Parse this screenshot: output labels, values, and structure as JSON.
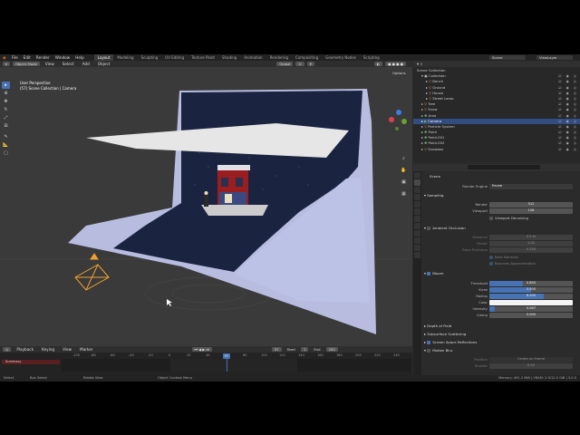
{
  "menu": {
    "items": [
      "File",
      "Edit",
      "Render",
      "Window",
      "Help"
    ],
    "workspaces": [
      "Layout",
      "Modeling",
      "Sculpting",
      "UV Editing",
      "Texture Paint",
      "Shading",
      "Animation",
      "Rendering",
      "Compositing",
      "Geometry Nodes",
      "Scripting"
    ],
    "active_workspace": "Layout",
    "scene": "Scene",
    "view_layer": "ViewLayer"
  },
  "viewport_header": {
    "mode": "Object Mode",
    "menus": [
      "View",
      "Select",
      "Add",
      "Object"
    ],
    "transform_orientation": "Global",
    "options": "Options"
  },
  "viewport": {
    "perspective_label": "User Perspective",
    "collection_label": "(57) Scene Collection | Camera"
  },
  "outliner": {
    "rows": [
      {
        "label": "Scene Collection",
        "indent": 0,
        "selected": false
      },
      {
        "label": "Collection",
        "indent": 1,
        "selected": false
      },
      {
        "label": "Bench",
        "indent": 2,
        "selected": false
      },
      {
        "label": "Ground",
        "indent": 2,
        "selected": false
      },
      {
        "label": "House",
        "indent": 2,
        "selected": false
      },
      {
        "label": "Street Lamp",
        "indent": 2,
        "selected": false
      },
      {
        "label": "Tree",
        "indent": 1,
        "selected": false
      },
      {
        "label": "Snow",
        "indent": 1,
        "selected": false
      },
      {
        "label": "Area",
        "indent": 1,
        "selected": false
      },
      {
        "label": "Camera",
        "indent": 1,
        "selected": true
      },
      {
        "label": "Particle System",
        "indent": 1,
        "selected": false
      },
      {
        "label": "Point",
        "indent": 1,
        "selected": false
      },
      {
        "label": "Point.001",
        "indent": 1,
        "selected": false
      },
      {
        "label": "Point.002",
        "indent": 1,
        "selected": false
      },
      {
        "label": "Snowbox",
        "indent": 1,
        "selected": false
      }
    ]
  },
  "properties": {
    "breadcrumb": "Scene",
    "render_engine_label": "Render Engine",
    "render_engine": "Eevee",
    "sampling": {
      "title": "Sampling",
      "render_label": "Render",
      "render": "512",
      "viewport_label": "Viewport",
      "viewport": "128",
      "denoising": "Viewport Denoising"
    },
    "ao": {
      "title": "Ambient Occlusion",
      "distance_label": "Distance",
      "distance": "0.2 m",
      "factor_label": "Factor",
      "factor": "1.00",
      "trace_label": "Trace Precision",
      "trace": "0.250",
      "bent_normals": "Bent Normals",
      "bounces": "Bounces Approximation"
    },
    "bloom": {
      "title": "Bloom",
      "threshold_label": "Threshold",
      "threshold": "0.800",
      "threshold_fill": 0.4,
      "knee_label": "Knee",
      "knee": "0.500",
      "knee_fill": 0.5,
      "radius_label": "Radius",
      "radius": "6.500",
      "radius_fill": 0.65,
      "color_label": "Color",
      "intensity_label": "Intensity",
      "intensity": "0.067",
      "intensity_fill": 0.07,
      "clamp_label": "Clamp",
      "clamp": "0.000"
    },
    "sections": [
      "Depth of Field",
      "Subsurface Scattering",
      "Screen Space Reflections",
      "Motion Blur"
    ],
    "motion_blur": {
      "position_label": "Position",
      "position": "Center on Frame",
      "shutter_label": "Shutter",
      "shutter": "0.50"
    }
  },
  "timeline": {
    "menus": [
      "Playback",
      "Keying",
      "View",
      "Marker"
    ],
    "current_frame": "57",
    "start_label": "Start",
    "start": "1",
    "end_label": "End",
    "end": "250",
    "ticks": [
      "-100",
      "-80",
      "-60",
      "-40",
      "-20",
      "0",
      "20",
      "40",
      "60",
      "80",
      "100",
      "120",
      "140",
      "160",
      "180",
      "200",
      "220",
      "240",
      "260"
    ],
    "summary": "Summary"
  },
  "status": {
    "select": "Select",
    "box_select": "Box Select",
    "rotate": "Rotate View",
    "context": "Object Context Menu",
    "info": "Memory: 491.2 MiB | VRAM: 2.9/12.0 GiB | 3.0.0"
  },
  "colors": {
    "accent": "#4772b3",
    "selected_row": "#334d80",
    "backdrop": "#1a2340"
  }
}
